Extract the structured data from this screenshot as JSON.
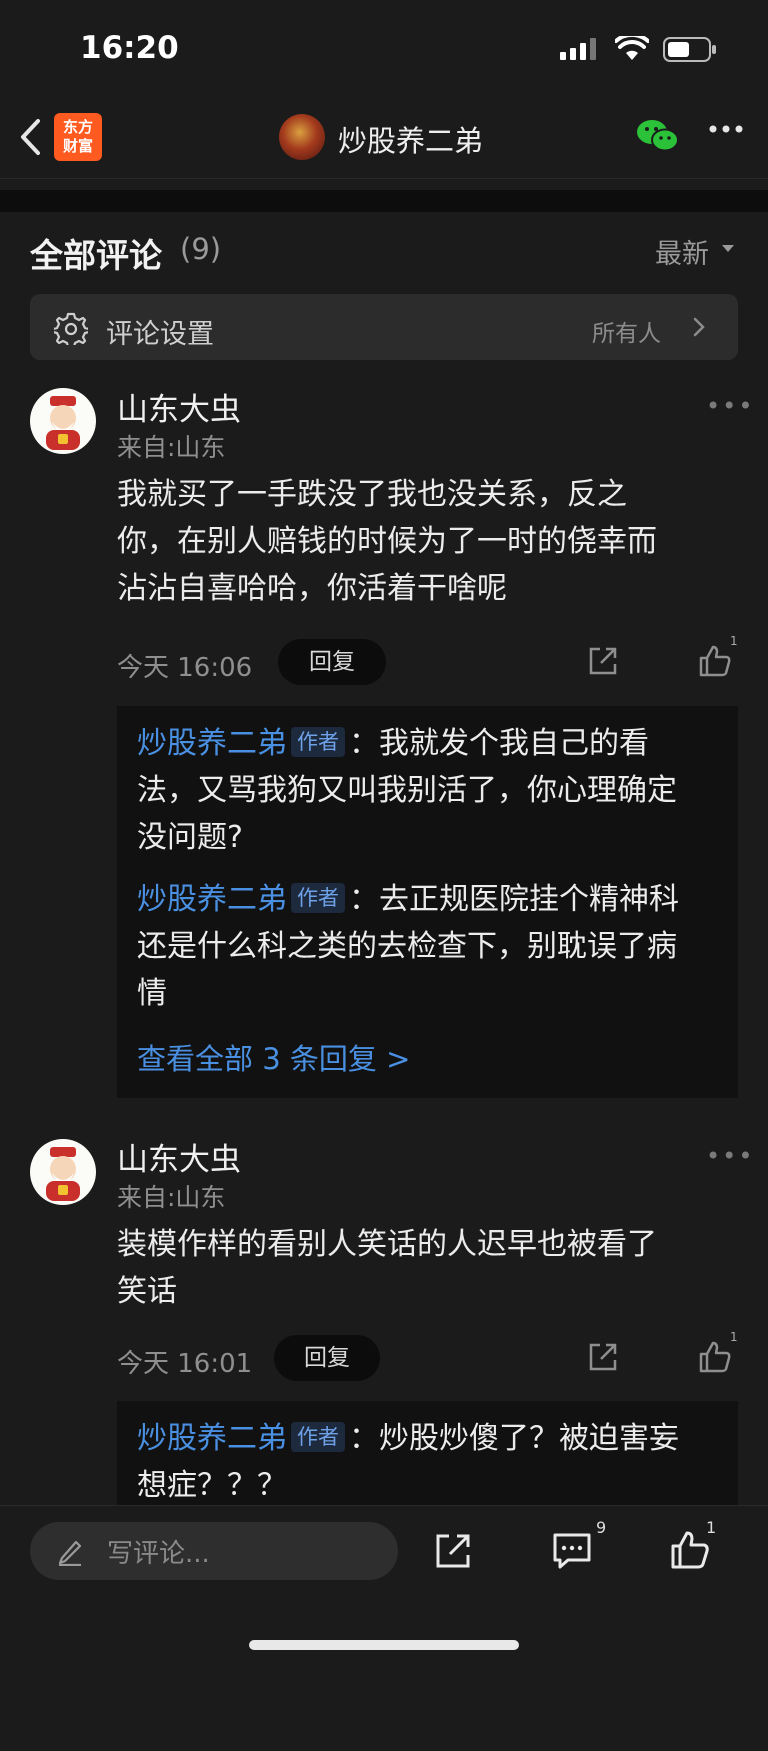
{
  "status_bar": {
    "time": "16:20"
  },
  "nav": {
    "logo_line1": "东方",
    "logo_line2": "财富",
    "title": "炒股养二弟"
  },
  "section": {
    "title": "全部评论",
    "count": "(9)",
    "sort": "最新"
  },
  "settings": {
    "label": "评论设置",
    "value": "所有人"
  },
  "comments": [
    {
      "author": "山东大虫",
      "location": "来自:山东",
      "text_lines": [
        "我就买了一手跌没了我也没关系，反之",
        "你，在别人赔钱的时候为了一时的侥幸而",
        "沾沾自喜哈哈，你活着干啥呢"
      ],
      "time": "今天 16:06",
      "reply_label": "回复",
      "like_count": "1",
      "replies": [
        {
          "name": "炒股养二弟",
          "tag": "作者",
          "lines": [
            "：我就发个我自己的看",
            "法，又骂我狗又叫我别活了，你心理确定",
            "没问题?"
          ]
        },
        {
          "name": "炒股养二弟",
          "tag": "作者",
          "lines": [
            "：去正规医院挂个精神科",
            "还是什么科之类的去检查下，别耽误了病",
            "情"
          ]
        }
      ],
      "view_all": "查看全部 3 条回复 >"
    },
    {
      "author": "山东大虫",
      "location": "来自:山东",
      "text_lines": [
        "装模作样的看别人笑话的人迟早也被看了",
        "笑话"
      ],
      "time": "今天 16:01",
      "reply_label": "回复",
      "like_count": "1",
      "replies": [
        {
          "name": "炒股养二弟",
          "tag": "作者",
          "lines": [
            "：炒股炒傻了？被迫害妄",
            "想症？？？"
          ]
        }
      ]
    }
  ],
  "bottom": {
    "placeholder": "写评论...",
    "comment_count": "9",
    "like_count": "1"
  }
}
